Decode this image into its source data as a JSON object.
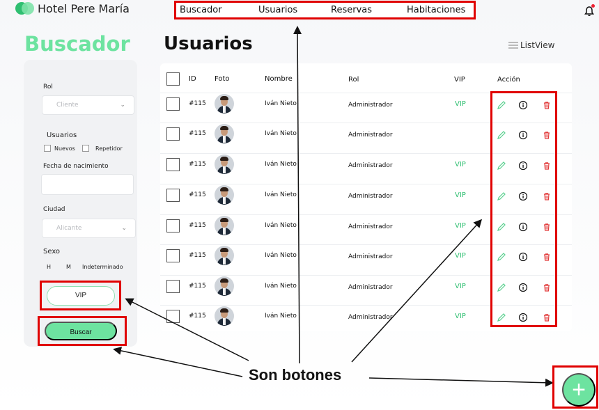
{
  "app": {
    "title": "Hotel Pere María"
  },
  "nav": {
    "items": [
      {
        "label": "Buscador"
      },
      {
        "label": "Usuarios"
      },
      {
        "label": "Reservas"
      },
      {
        "label": "Habitaciones"
      }
    ]
  },
  "filters": {
    "title": "Buscador",
    "rol_label": "Rol",
    "rol_value": "Cliente",
    "usuarios_label": "Usuarios",
    "nuevos_label": "Nuevos",
    "repetidor_label": "Repetidor",
    "fecha_label": "Fecha de nacimiento",
    "ciudad_label": "Ciudad",
    "ciudad_value": "Alicante",
    "sexo_label": "Sexo",
    "sexo_h": "H",
    "sexo_m": "M",
    "sexo_ind": "Indeterminado",
    "vip_button": "VIP",
    "buscar_button": "Buscar"
  },
  "main": {
    "title": "Usuarios",
    "view_toggle": "ListView",
    "columns": [
      "ID",
      "Foto",
      "Nombre",
      "Rol",
      "VIP",
      "Acción"
    ],
    "rows": [
      {
        "id": "#115",
        "nombre": "Iván Nieto",
        "rol": "Administrador",
        "vip": "VIP"
      },
      {
        "id": "#115",
        "nombre": "Iván Nieto",
        "rol": "Administrador",
        "vip": ""
      },
      {
        "id": "#115",
        "nombre": "Iván Nieto",
        "rol": "Administrador",
        "vip": "VIP"
      },
      {
        "id": "#115",
        "nombre": "Iván Nieto",
        "rol": "Administrador",
        "vip": "VIP"
      },
      {
        "id": "#115",
        "nombre": "Iván Nieto",
        "rol": "Administrador",
        "vip": "VIP"
      },
      {
        "id": "#115",
        "nombre": "Iván Nieto",
        "rol": "Administrador",
        "vip": "VIP"
      },
      {
        "id": "#115",
        "nombre": "Iván Nieto",
        "rol": "Administrador",
        "vip": "VIP"
      },
      {
        "id": "#115",
        "nombre": "Iván Nieto",
        "rol": "Administrador",
        "vip": "VIP"
      }
    ]
  },
  "annotation": {
    "text": "Son botones"
  },
  "colors": {
    "accent": "#6de3a0",
    "vip": "#2fbf71",
    "delete": "#e23b3b",
    "highlight": "#e00000"
  },
  "icons": {
    "edit": "pencil-icon",
    "info": "info-icon",
    "delete": "trash-icon",
    "add": "plus-icon",
    "notifications": "bell-icon",
    "list": "list-icon"
  }
}
